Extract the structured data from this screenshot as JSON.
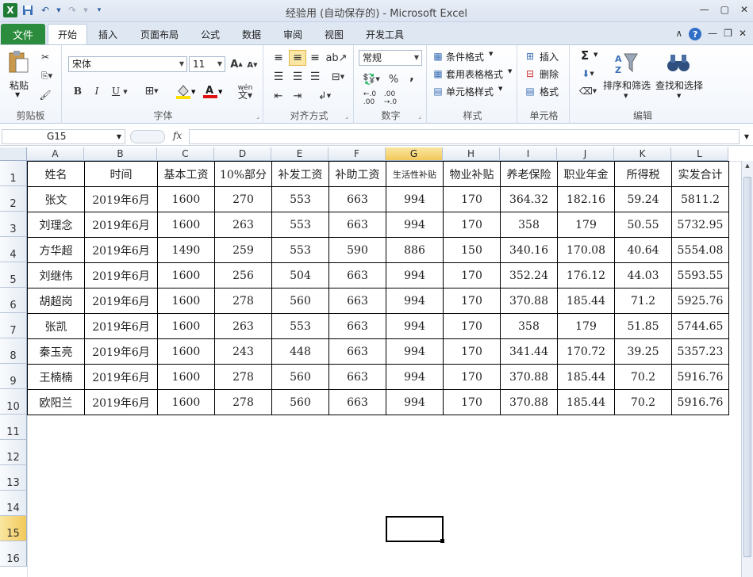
{
  "window": {
    "title": "经验用 (自动保存的)  -  Microsoft Excel",
    "app_icon": "X",
    "buttons": [
      "—",
      "▢",
      "✕"
    ]
  },
  "tabs": {
    "file": "文件",
    "items": [
      "开始",
      "插入",
      "页面布局",
      "公式",
      "数据",
      "审阅",
      "视图",
      "开发工具"
    ],
    "active": "开始"
  },
  "ribbon": {
    "clipboard": {
      "label": "剪贴板",
      "paste": "粘贴"
    },
    "font": {
      "label": "字体",
      "name": "宋体",
      "size": "11",
      "bold": "B",
      "italic": "I",
      "underline": "U"
    },
    "alignment": {
      "label": "对齐方式"
    },
    "number": {
      "label": "数字",
      "format": "常规",
      "percent": "%",
      "comma": ","
    },
    "styles": {
      "label": "样式",
      "conditional": "条件格式",
      "table": "套用表格格式",
      "cell": "单元格样式"
    },
    "cells": {
      "label": "单元格",
      "insert": "插入",
      "delete": "删除",
      "format": "格式"
    },
    "editing": {
      "label": "编辑",
      "sum": "Σ",
      "sort": "排序和筛选",
      "find": "查找和选择"
    }
  },
  "formula_bar": {
    "name_box": "G15",
    "fx": "fx",
    "value": ""
  },
  "sheet": {
    "selected_cell": "G15",
    "selected_column": "G",
    "selected_row": "15",
    "columns": [
      "A",
      "B",
      "C",
      "D",
      "E",
      "F",
      "G",
      "H",
      "I",
      "J",
      "K",
      "L"
    ],
    "rows": [
      "1",
      "2",
      "3",
      "4",
      "5",
      "6",
      "7",
      "8",
      "9",
      "10",
      "11",
      "12",
      "13",
      "14",
      "15",
      "16"
    ],
    "headers": [
      "姓名",
      "时间",
      "基本工资",
      "10%部分",
      "补发工资",
      "补助工资",
      "生活性补贴",
      "物业补贴",
      "养老保险",
      "职业年金",
      "所得税",
      "实发合计"
    ],
    "data": [
      [
        "张文",
        "2019年6月",
        "1600",
        "270",
        "553",
        "663",
        "994",
        "170",
        "364.32",
        "182.16",
        "59.24",
        "5811.2"
      ],
      [
        "刘理念",
        "2019年6月",
        "1600",
        "263",
        "553",
        "663",
        "994",
        "170",
        "358",
        "179",
        "50.55",
        "5732.95"
      ],
      [
        "方华超",
        "2019年6月",
        "1490",
        "259",
        "553",
        "590",
        "886",
        "150",
        "340.16",
        "170.08",
        "40.64",
        "5554.08"
      ],
      [
        "刘继伟",
        "2019年6月",
        "1600",
        "256",
        "504",
        "663",
        "994",
        "170",
        "352.24",
        "176.12",
        "44.03",
        "5593.55"
      ],
      [
        "胡超岗",
        "2019年6月",
        "1600",
        "278",
        "560",
        "663",
        "994",
        "170",
        "370.88",
        "185.44",
        "71.2",
        "5925.76"
      ],
      [
        "张凯",
        "2019年6月",
        "1600",
        "263",
        "553",
        "663",
        "994",
        "170",
        "358",
        "179",
        "51.85",
        "5744.65"
      ],
      [
        "秦玉亮",
        "2019年6月",
        "1600",
        "243",
        "448",
        "663",
        "994",
        "170",
        "341.44",
        "170.72",
        "39.25",
        "5357.23"
      ],
      [
        "王楠楠",
        "2019年6月",
        "1600",
        "278",
        "560",
        "663",
        "994",
        "170",
        "370.88",
        "185.44",
        "70.2",
        "5916.76"
      ],
      [
        "欧阳兰",
        "2019年6月",
        "1600",
        "278",
        "560",
        "663",
        "994",
        "170",
        "370.88",
        "185.44",
        "70.2",
        "5916.76"
      ]
    ]
  }
}
